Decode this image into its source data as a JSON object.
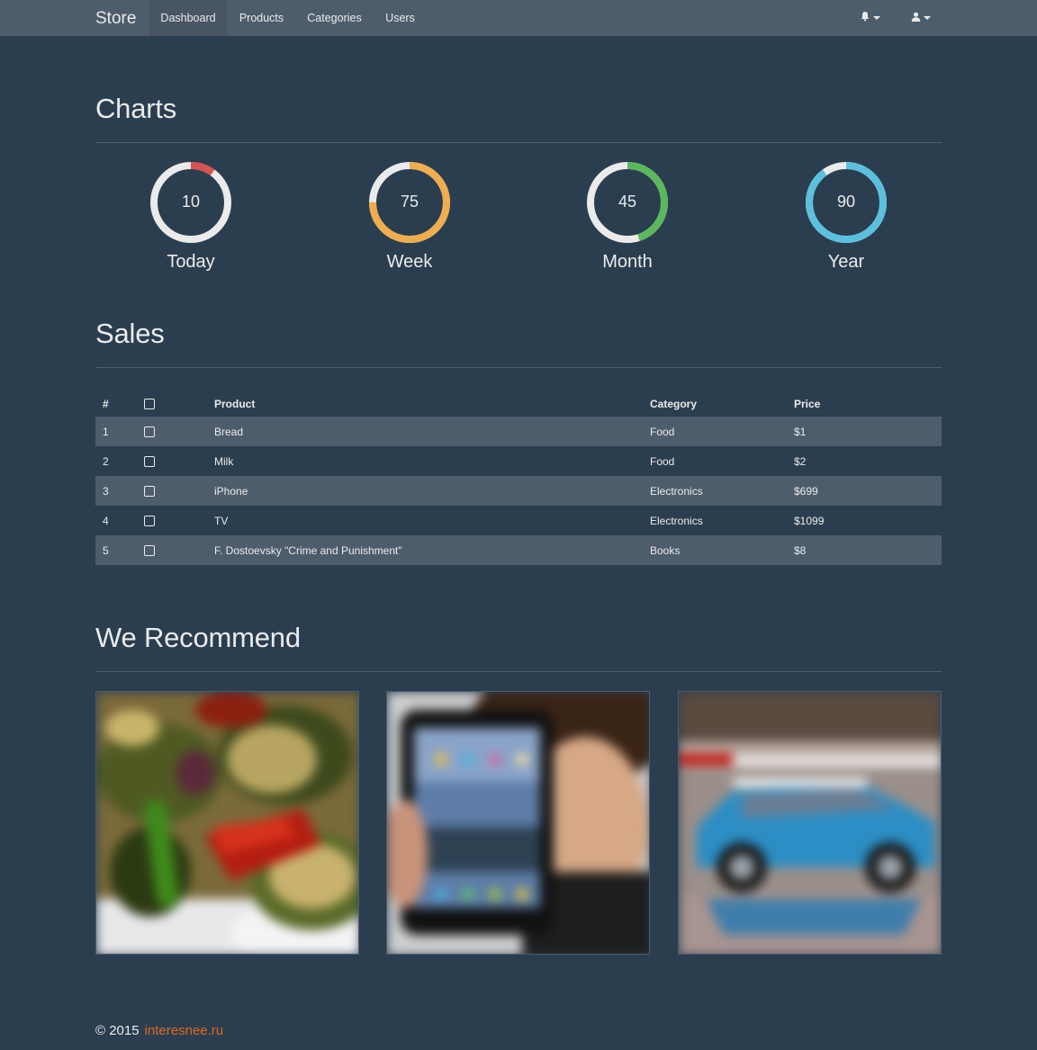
{
  "navbar": {
    "brand": "Store",
    "items": [
      {
        "label": "Dashboard",
        "active": true
      },
      {
        "label": "Products",
        "active": false
      },
      {
        "label": "Categories",
        "active": false
      },
      {
        "label": "Users",
        "active": false
      }
    ],
    "right_icons": [
      "bell-icon",
      "user-icon"
    ]
  },
  "charts": {
    "title": "Charts",
    "donuts": [
      {
        "value": "10",
        "label": "Today",
        "percent": 10,
        "color": "#d9534f"
      },
      {
        "value": "75",
        "label": "Week",
        "percent": 75,
        "color": "#f0ad4e"
      },
      {
        "value": "45",
        "label": "Month",
        "percent": 45,
        "color": "#5cb85c"
      },
      {
        "value": "90",
        "label": "Year",
        "percent": 90,
        "color": "#5bc0de"
      }
    ],
    "track_color": "#ebebeb"
  },
  "sales": {
    "title": "Sales",
    "columns": [
      "#",
      "",
      "Product",
      "Category",
      "Price"
    ],
    "rows": [
      {
        "num": "1",
        "product": "Bread",
        "category": "Food",
        "price": "$1"
      },
      {
        "num": "2",
        "product": "Milk",
        "category": "Food",
        "price": "$2"
      },
      {
        "num": "3",
        "product": "iPhone",
        "category": "Electronics",
        "price": "$699"
      },
      {
        "num": "4",
        "product": "TV",
        "category": "Electronics",
        "price": "$1099"
      },
      {
        "num": "5",
        "product": "F. Dostoevsky \"Crime and Punishment\"",
        "category": "Books",
        "price": "$8"
      }
    ]
  },
  "recommend": {
    "title": "We Recommend",
    "images": [
      "grilled-vegetables-photo",
      "tablet-person-photo",
      "blue-car-photo"
    ]
  },
  "footer": {
    "copyright": "© 2015",
    "link": "interesnee.ru"
  },
  "colors": {
    "background": "#2b3e50",
    "navbar": "#4e5d6c",
    "accent": "#df691a"
  }
}
